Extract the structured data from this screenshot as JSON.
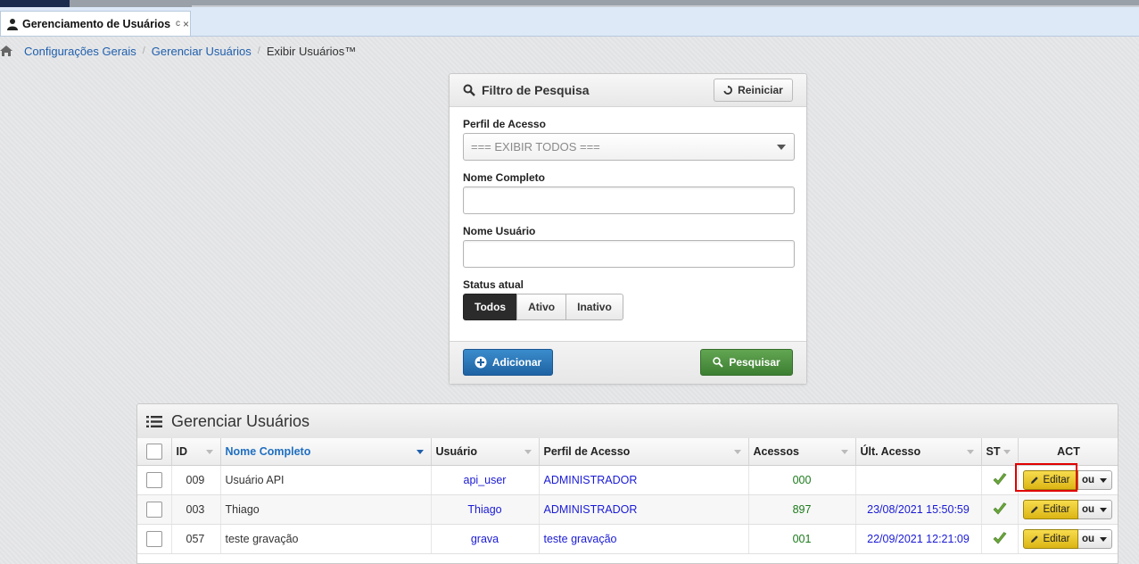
{
  "window": {
    "tab_title": "Gerenciamento de Usuários",
    "tab_refresh": "c",
    "tab_close": "×"
  },
  "breadcrumb": {
    "items": [
      "Configurações Gerais",
      "Gerenciar Usuários"
    ],
    "current": "Exibir Usuários™"
  },
  "filter": {
    "title": "Filtro de Pesquisa",
    "reset_label": "Reiniciar",
    "perfil_label": "Perfil de Acesso",
    "perfil_value": "=== EXIBIR TODOS ===",
    "nome_completo_label": "Nome Completo",
    "nome_completo_value": "",
    "nome_usuario_label": "Nome Usuário",
    "nome_usuario_value": "",
    "status_label": "Status atual",
    "status_options": [
      "Todos",
      "Ativo",
      "Inativo"
    ],
    "status_selected": "Todos",
    "add_label": "Adicionar",
    "search_label": "Pesquisar"
  },
  "grid": {
    "title": "Gerenciar Usuários",
    "columns": [
      "ID",
      "Nome Completo",
      "Usuário",
      "Perfil de Acesso",
      "Acessos",
      "Últ. Acesso",
      "ST",
      "ACT"
    ],
    "rows": [
      {
        "id": "009",
        "nome": "Usuário API",
        "usuario": "api_user",
        "perfil": "ADMINISTRADOR",
        "acessos": "000",
        "ultimo": ""
      },
      {
        "id": "003",
        "nome": "Thiago",
        "usuario": "Thiago",
        "perfil": "ADMINISTRADOR",
        "acessos": "897",
        "ultimo": "23/08/2021 15:50:59"
      },
      {
        "id": "057",
        "nome": "teste gravação",
        "usuario": "grava",
        "perfil": "teste gravação",
        "acessos": "001",
        "ultimo": "22/09/2021 12:21:09"
      }
    ],
    "edit_label": "Editar",
    "ou_label": "ou"
  },
  "colors": {
    "link": "#1f5fad",
    "add_button": "#2a77b8",
    "search_button": "#4f9142",
    "edit_button": "#ecc92e",
    "highlight": "#e00000"
  }
}
